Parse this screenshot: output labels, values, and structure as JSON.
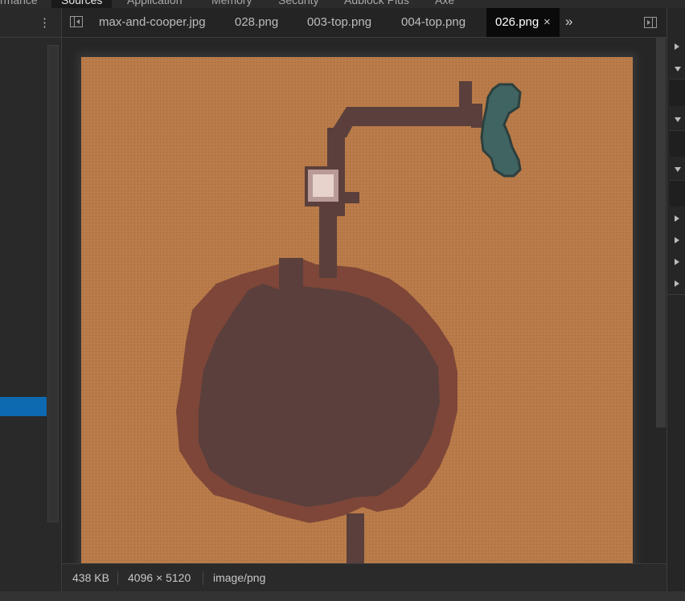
{
  "panel_tabs": [
    {
      "label": "rmance"
    },
    {
      "label": "Sources"
    },
    {
      "label": "Application"
    },
    {
      "label": "Memory"
    },
    {
      "label": "Security"
    },
    {
      "label": "Adblock Plus"
    },
    {
      "label": "Axe"
    }
  ],
  "editor": {
    "tabs": [
      {
        "label": "max-and-cooper.jpg"
      },
      {
        "label": "028.png"
      },
      {
        "label": "003-top.png"
      },
      {
        "label": "004-top.png"
      },
      {
        "label": "026.png",
        "active": true
      }
    ],
    "close_glyph": "×",
    "more_glyph": "»"
  },
  "status": {
    "file_size": "438 KB",
    "dimensions": "4096 × 5120",
    "mime_type": "image/png"
  },
  "left_toolbar": {
    "menu_glyph": "⋮"
  },
  "colors": {
    "accent_selection": "#0e6ab0",
    "sand": "#b87a48",
    "path": "#5a3f3c",
    "rim": "#7d4638",
    "water": "#3f6462"
  },
  "icons": [
    "toggle-navigator-icon",
    "toggle-debugger-icon",
    "more-tabs-icon",
    "kebab-menu-icon",
    "close-icon",
    "expand-arrow-icon",
    "collapse-arrow-icon"
  ]
}
